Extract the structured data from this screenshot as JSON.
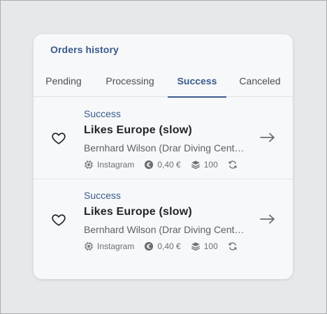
{
  "card": {
    "title": "Orders history"
  },
  "tabs": [
    {
      "label": "Pending",
      "active": false
    },
    {
      "label": "Processing",
      "active": false
    },
    {
      "label": "Success",
      "active": true
    },
    {
      "label": "Canceled",
      "active": false
    }
  ],
  "orders": [
    {
      "status": "Success",
      "service": "Likes Europe (slow)",
      "customer": "Bernhard Wilson (Drar Diving Center)",
      "platform": "Instagram",
      "price": "0,40 €",
      "quantity": "100"
    },
    {
      "status": "Success",
      "service": "Likes Europe (slow)",
      "customer": "Bernhard Wilson (Drar Diving Center)",
      "platform": "Instagram",
      "price": "0,40 €",
      "quantity": "100"
    }
  ],
  "colors": {
    "accent": "#3a5a8c",
    "card_background": "#f7f8f9",
    "page_background": "#e7e8ea"
  },
  "icons": {
    "favorite": "heart-outline-icon",
    "platform": "chip-icon",
    "price": "euro-coin-icon",
    "quantity": "layers-icon",
    "refill": "refresh-icon",
    "open": "arrow-right-icon"
  }
}
